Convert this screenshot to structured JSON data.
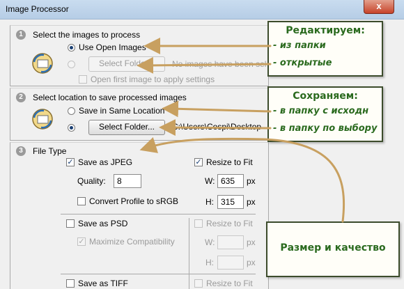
{
  "window": {
    "title": "Image Processor",
    "close_glyph": "x"
  },
  "section1": {
    "number": "1",
    "title": "Select the images to process",
    "use_open_images": "Use Open Images",
    "select_folder": "Select Folder...",
    "folder_hint": "No images have been sel",
    "open_first": "Open first image to apply settings",
    "selected": "use_open_images"
  },
  "section2": {
    "number": "2",
    "title": "Select location to save processed images",
    "save_same": "Save in Same Location",
    "select_folder": "Select Folder...",
    "path": "C:\\Users\\Cospi\\Desktop",
    "selected": "select_folder"
  },
  "section3": {
    "number": "3",
    "title": "File Type",
    "jpeg": {
      "label": "Save as JPEG",
      "checked": true,
      "quality_label": "Quality:",
      "quality": "8",
      "convert_label": "Convert Profile to sRGB",
      "convert_checked": false
    },
    "jpeg_resize": {
      "label": "Resize to Fit",
      "checked": true,
      "w_label": "W:",
      "w": "635",
      "w_unit": "px",
      "h_label": "H:",
      "h": "315",
      "h_unit": "px"
    },
    "psd": {
      "label": "Save as PSD",
      "checked": false,
      "max_label": "Maximize Compatibility",
      "max_checked": true
    },
    "psd_resize": {
      "label": "Resize to Fit",
      "w_label": "W:",
      "w_unit": "px",
      "h_label": "H:",
      "h_unit": "px"
    },
    "tiff": {
      "label": "Save as TIFF"
    },
    "tiff_resize": {
      "label": "Resize to Fit"
    }
  },
  "callouts": {
    "edit": {
      "head": "Редактируем:",
      "lines": [
        "- из папки",
        "- открытые"
      ]
    },
    "save": {
      "head": "Сохраняем:",
      "lines": [
        "- в папку с исходн",
        "- в папку по выбору"
      ]
    },
    "size": {
      "head": "Размер и качество"
    }
  },
  "colors": {
    "callout_text": "#2a6a1e",
    "callout_border": "#3c4c2c",
    "arrow": "#c8a060"
  }
}
